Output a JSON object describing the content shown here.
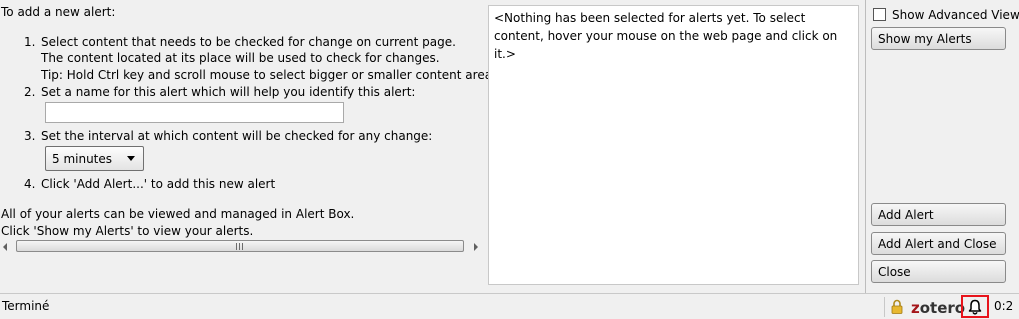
{
  "instructions": {
    "heading": "To add a new alert:",
    "step1_number": "1.",
    "step1_line1": "Select content that needs to be checked for change on current page.",
    "step1_line2": "The content located at its place will be used to check for changes.",
    "step1_line3": "Tip: Hold Ctrl key and scroll mouse to select bigger or smaller content area.",
    "step2_number": "2.",
    "step2_text": "Set a name for this alert which will help you identify this alert:",
    "name_value": "",
    "step3_number": "3.",
    "step3_text": "Set the interval at which content will be checked for any change:",
    "interval_selected": "5 minutes",
    "step4_number": "4.",
    "step4_text": "Click 'Add Alert...' to add this new alert",
    "footer_line1": "All of your alerts can be viewed and managed in Alert Box.",
    "footer_line2": "Click 'Show my Alerts' to view your alerts."
  },
  "message": {
    "text": "<Nothing has been selected for alerts yet. To select content, hover your mouse on the web page and click on it.>"
  },
  "right_panel": {
    "show_advanced_label": "Show Advanced View",
    "show_advanced_checked": false,
    "show_my_alerts_label": "Show my Alerts",
    "add_alert_label": "Add Alert",
    "add_alert_close_label": "Add Alert and Close",
    "close_label": "Close"
  },
  "status_bar": {
    "status_text": "Terminé",
    "zotero_label": "zotero",
    "counter_text": "0:2",
    "icons": [
      "lock-icon",
      "zotero-logo",
      "bell-icon"
    ],
    "highlight_color": "#e8141c"
  }
}
